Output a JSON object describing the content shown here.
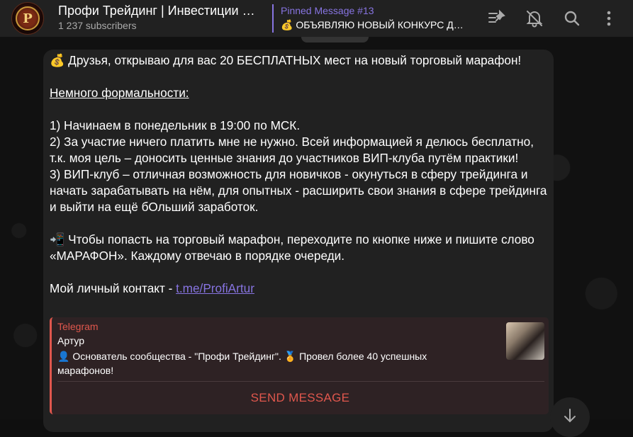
{
  "header": {
    "title": "Профи Трейдинг | Инвестиции | Фондовый рынок | Трейдинг",
    "subscribers": "1 237 subscribers",
    "avatar_letter": "P",
    "pinned_title": "Pinned Message #13",
    "pinned_text": "💰 ОБЪЯВЛЯЮ НОВЫЙ КОНКУРС ДЛЯ ПОДПИСЧИКОВ",
    "icons": [
      "pinned-list-icon",
      "mute-icon",
      "search-icon",
      "more-icon"
    ]
  },
  "message": {
    "line1": "💰 Друзья, открываю для вас 20 БЕСПЛАТНЫХ мест на новый торговый марафон!",
    "formal_heading": "Немного формальности:",
    "point1": "1) Начинаем в понедельник в 19:00 по МСК.",
    "point2": "2) За участие ничего платить мне не нужно. Всей информацией я делюсь бесплатно, т.к. моя цель – доносить ценные знания до участников ВИП-клуба путём практики!",
    "point3": "3) ВИП-клуб – отличная возможность для новичков - окунуться в сферу трейдинга и начать зарабатывать на нём, для опытных - расширить свои знания в сфере трейдинга и выйти на ещё бОльший заработок.",
    "cta": "📲 Чтобы попасть на торговый марафон, переходите по кнопке ниже и пишите слово «МАРАФОН». Каждому отвечаю в порядке очереди.",
    "contact_prefix": "Мой личный контакт - ",
    "contact_link": "t.me/ProfiArtur"
  },
  "preview": {
    "site": "Telegram",
    "title": "Артур",
    "description": "👤 Основатель сообщества - \"Профи Трейдинг\". 🏅 Провел более 40 успешных марафонов!",
    "button": "SEND MESSAGE"
  },
  "colors": {
    "accent": "#8774e1",
    "preview_accent": "#e0574d",
    "header_bg": "#212121",
    "bubble_bg": "#212121"
  }
}
